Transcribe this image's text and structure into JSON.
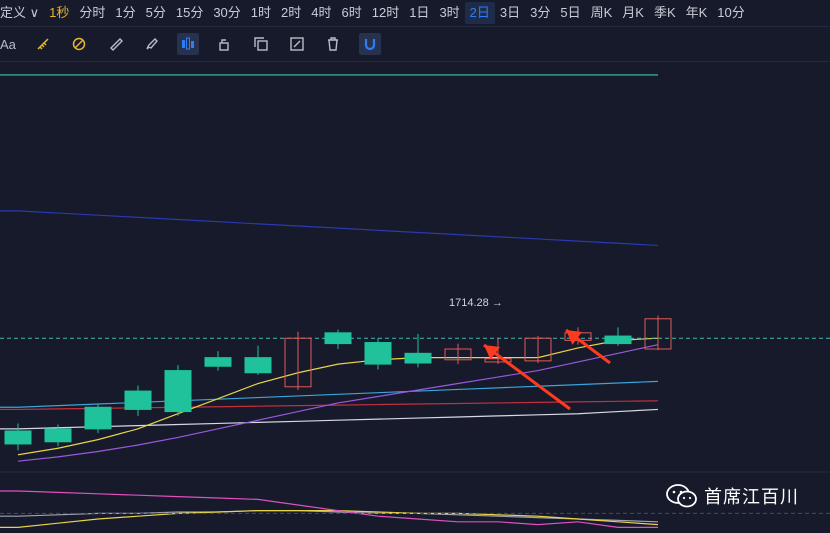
{
  "timeframes": [
    {
      "label": "定义",
      "suffix": "∨",
      "key": "custom"
    },
    {
      "label": "1秒",
      "accent": true
    },
    {
      "label": "分时"
    },
    {
      "label": "1分"
    },
    {
      "label": "5分"
    },
    {
      "label": "15分"
    },
    {
      "label": "30分"
    },
    {
      "label": "1时"
    },
    {
      "label": "2时"
    },
    {
      "label": "4时"
    },
    {
      "label": "6时"
    },
    {
      "label": "12时"
    },
    {
      "label": "1日"
    },
    {
      "label": "3时"
    },
    {
      "label": "2日",
      "active": true
    },
    {
      "label": "3日"
    },
    {
      "label": "3分"
    },
    {
      "label": "5日"
    },
    {
      "label": "周K"
    },
    {
      "label": "月K"
    },
    {
      "label": "季K"
    },
    {
      "label": "年K"
    },
    {
      "label": "10分"
    }
  ],
  "tools": [
    {
      "name": "text-tool",
      "label": "Aa"
    },
    {
      "name": "ruler-icon"
    },
    {
      "name": "eraser-icon"
    },
    {
      "name": "measure-icon"
    },
    {
      "name": "brush-icon"
    },
    {
      "name": "candle-mode-icon",
      "active": true
    },
    {
      "name": "lock-icon"
    },
    {
      "name": "copy-icon"
    },
    {
      "name": "edit-icon"
    },
    {
      "name": "trash-icon"
    },
    {
      "name": "magnet-icon",
      "active": true
    }
  ],
  "colors": {
    "up": "#e05a5a",
    "down": "#1fc29a",
    "ma5": "#d8d8e4",
    "ma10": "#9a58e0",
    "ma20": "#e8d44a",
    "ma60": "#c33040",
    "ma120": "#3aa5d8",
    "long_navy": "#2a3ab0",
    "top_cyan": "#38c7b8",
    "price_line": "#3fb9b0",
    "annotation": "#ff3b1f",
    "osc_pink": "#e050c0",
    "osc_yellow": "#e8d44a",
    "osc_gray": "#a0a0b0"
  },
  "price_label": {
    "text": "1714.28",
    "arrow": "→"
  },
  "chart_data": {
    "type": "candlestick",
    "x_axis": "2日",
    "candles": [
      {
        "o": 38,
        "c": 26,
        "h": 45,
        "l": 20
      },
      {
        "o": 40,
        "c": 28,
        "h": 44,
        "l": 24
      },
      {
        "o": 60,
        "c": 40,
        "h": 63,
        "l": 36
      },
      {
        "o": 75,
        "c": 58,
        "h": 80,
        "l": 52
      },
      {
        "o": 94,
        "c": 56,
        "h": 99,
        "l": 52
      },
      {
        "o": 106,
        "c": 98,
        "h": 112,
        "l": 94
      },
      {
        "o": 106,
        "c": 92,
        "h": 117,
        "l": 90
      },
      {
        "o": 79,
        "c": 124,
        "h": 130,
        "l": 76
      },
      {
        "o": 129,
        "c": 119,
        "h": 132,
        "l": 114
      },
      {
        "o": 120,
        "c": 100,
        "h": 124,
        "l": 95
      },
      {
        "o": 110,
        "c": 101,
        "h": 128,
        "l": 97
      },
      {
        "o": 104,
        "c": 114,
        "h": 119,
        "l": 100
      },
      {
        "o": 102,
        "c": 105,
        "h": 124,
        "l": 100
      },
      {
        "o": 103,
        "c": 124,
        "h": 126,
        "l": 101
      },
      {
        "o": 122,
        "c": 129,
        "h": 134,
        "l": 118
      },
      {
        "o": 126,
        "c": 119,
        "h": 134,
        "l": 117
      },
      {
        "o": 114,
        "c": 142,
        "h": 145,
        "l": 113
      }
    ],
    "ma5": [
      16,
      22,
      30,
      40,
      54,
      68,
      82,
      92,
      100,
      104,
      106,
      106,
      106,
      106,
      115,
      122,
      124
    ],
    "ma10": [
      10,
      14,
      19,
      25,
      32,
      40,
      48,
      56,
      64,
      70,
      76,
      82,
      88,
      94,
      102,
      110,
      118
    ],
    "ma20": [
      40,
      41,
      42,
      43,
      44,
      45,
      46,
      47,
      48,
      49,
      50,
      51,
      52,
      53,
      54,
      56,
      58
    ],
    "ma60": [
      58,
      58.5,
      59,
      59.5,
      60,
      60.5,
      61,
      61.5,
      62,
      62.5,
      63,
      63.5,
      64,
      64.5,
      65,
      65.5,
      66
    ],
    "ma120": [
      60,
      61.5,
      63,
      64.5,
      66,
      67.5,
      69,
      70.5,
      72,
      73.5,
      75,
      76.5,
      78,
      79.5,
      81,
      82.5,
      84
    ],
    "long_navy": [
      242,
      240,
      238,
      236,
      234,
      232,
      230,
      228,
      226,
      224,
      222,
      220,
      218,
      216,
      214,
      212,
      210
    ],
    "top_cyan": [
      368,
      368,
      368,
      368,
      368,
      368,
      368,
      368,
      368,
      368,
      368,
      368,
      368,
      368,
      368,
      368,
      368
    ],
    "current_price": 124,
    "y_range": [
      0,
      380
    ],
    "oscillator": {
      "pink": [
        30,
        29,
        28,
        27,
        26,
        25,
        24,
        20,
        16,
        12,
        10,
        8,
        8,
        6,
        8,
        4,
        4
      ],
      "yellow": [
        4,
        7,
        10,
        12,
        14,
        15,
        16,
        16,
        16,
        15,
        14,
        14,
        13,
        12,
        10,
        8,
        6
      ],
      "gray": [
        12,
        13,
        14,
        14,
        15,
        15,
        16,
        16,
        15,
        14,
        14,
        13,
        12,
        11,
        10,
        9,
        8
      ],
      "y_range": [
        0,
        40
      ]
    }
  },
  "watermark": {
    "text": "首席江百川"
  }
}
